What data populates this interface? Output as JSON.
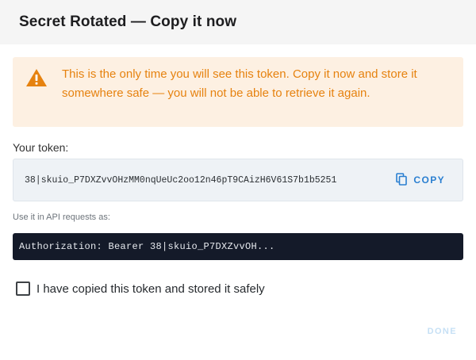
{
  "dialog": {
    "title": "Secret Rotated — Copy it now",
    "warning": {
      "icon": "warning-triangle-icon",
      "color": "#e6820f",
      "background": "#fdf0e2",
      "text": "This is the only time you will see this token. Copy it now and store it somewhere safe — you will not be able to retrieve it again."
    },
    "token": {
      "label": "Your token:",
      "value": "38|skuio_P7DXZvvOHzMM0nqUeUc2oo12n46pT9CAizH6V61S7b1b5251",
      "copy_label": "COPY",
      "copy_icon": "copy-icon"
    },
    "usage": {
      "label": "Use it in API requests as:",
      "code": "Authorization: Bearer 38|skuio_P7DXZvvOH..."
    },
    "confirm": {
      "label": "I have copied this token and stored it safely",
      "checked": false
    },
    "done_label": "DONE",
    "colors": {
      "accent": "#2a7fd1",
      "code_background": "#141a29",
      "disabled": "#c6e0f5"
    }
  }
}
